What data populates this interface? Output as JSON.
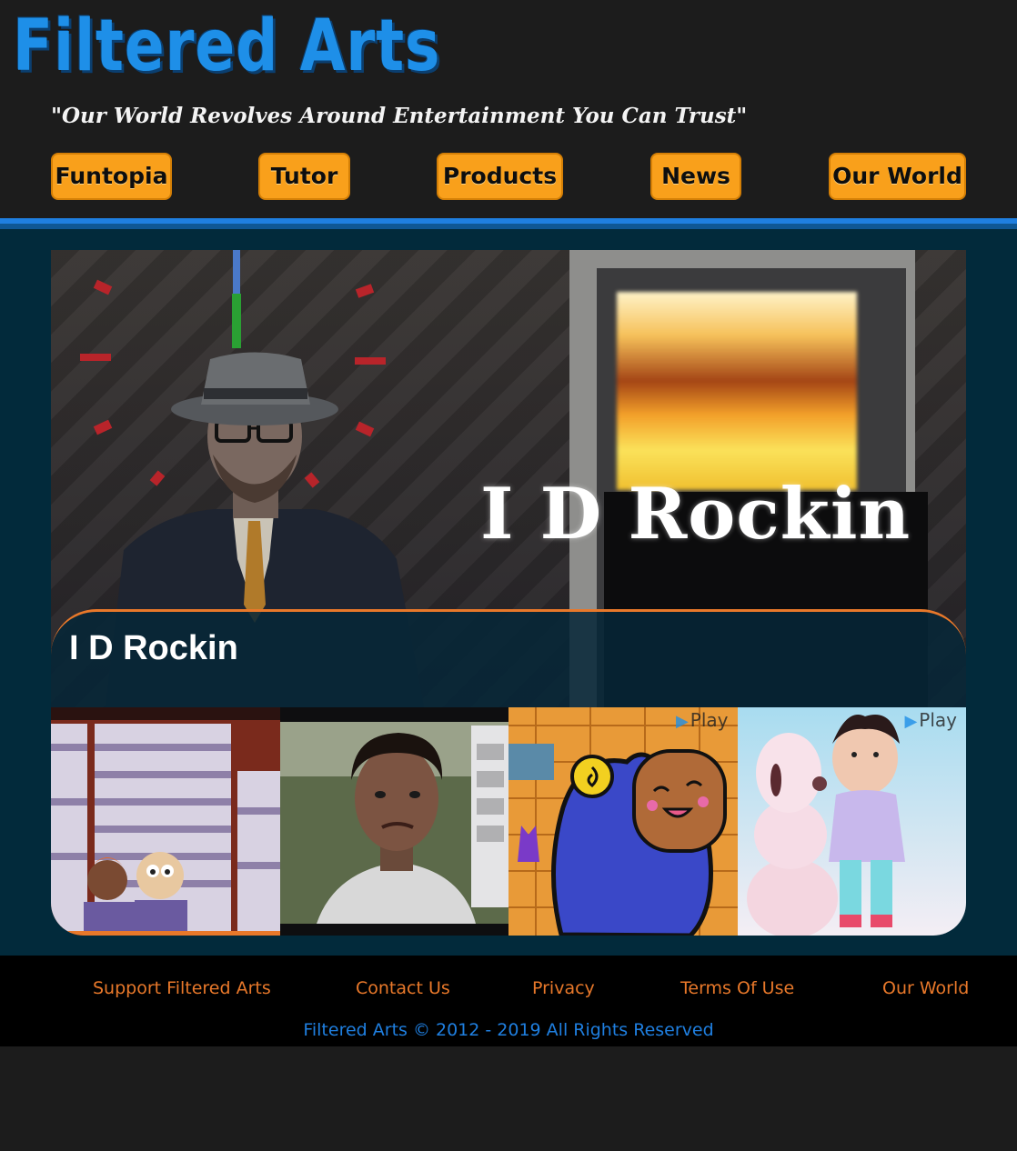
{
  "brand": {
    "logo_text": "Filtered Arts",
    "tagline": "\"Our World Revolves Around Entertainment You Can Trust\"",
    "primary_color": "#1e8fe8",
    "accent_color": "#f9a01b"
  },
  "nav": {
    "items": [
      {
        "label": "Funtopia"
      },
      {
        "label": "Tutor"
      },
      {
        "label": "Products"
      },
      {
        "label": "News"
      },
      {
        "label": "Our World"
      }
    ]
  },
  "featured": {
    "image_overlay_text": "I D Rockin",
    "caption_title": "I D Rockin"
  },
  "thumbnails": [
    {
      "icon": "cartoon-characters-thumbnail"
    },
    {
      "icon": "3d-character-thumbnail"
    },
    {
      "icon": "blue-creature-thumbnail",
      "badge": "Play"
    },
    {
      "icon": "snowman-child-thumbnail",
      "badge": "Play"
    }
  ],
  "footer": {
    "links": [
      {
        "label": "Support Filtered Arts"
      },
      {
        "label": "Contact Us"
      },
      {
        "label": "Privacy"
      },
      {
        "label": "Terms Of Use"
      },
      {
        "label": "Our World"
      }
    ],
    "copyright": "Filtered Arts © 2012 - 2019 All Rights Reserved",
    "link_color": "#e8782a",
    "copyright_color": "#1f7fe0"
  }
}
